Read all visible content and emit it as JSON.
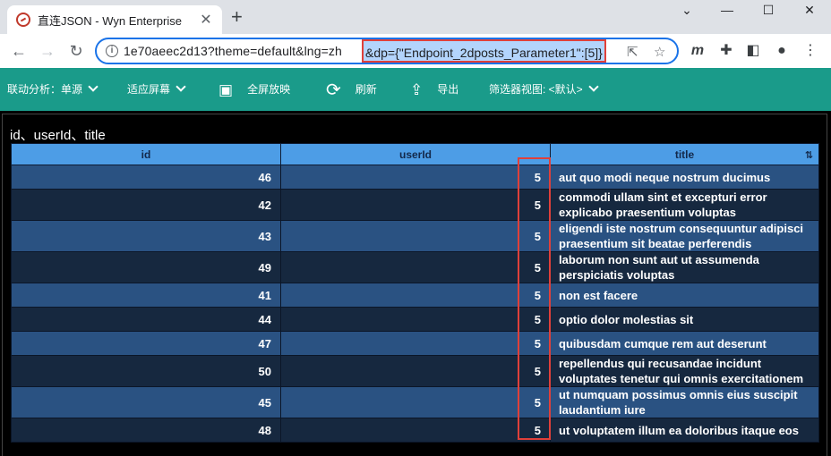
{
  "browser": {
    "tab_title": "直连JSON - Wyn Enterprise",
    "tab_close": "✕",
    "new_tab": "+",
    "url_prefix": "1e70aeec2d13?theme=default&lng=zh",
    "url_selected": "&dp={\"Endpoint_2dposts_Parameter1\":[5]}",
    "window": {
      "minimize": "⌄",
      "minimize2": "—",
      "maximize": "☐",
      "close": "✕"
    }
  },
  "toolbar": {
    "items": [
      {
        "label": "联动分析：单源",
        "icon": "",
        "has_chevron": true
      },
      {
        "label": "适应屏幕",
        "icon": "",
        "has_chevron": true
      },
      {
        "label": "全屏放映",
        "icon": "▣",
        "has_chevron": false
      },
      {
        "label": "刷新",
        "icon": "⟳",
        "has_chevron": false
      },
      {
        "label": "导出",
        "icon": "⇪",
        "has_chevron": false
      },
      {
        "label": "筛选器视图: <默认>",
        "icon": "",
        "has_chevron": true
      }
    ]
  },
  "report": {
    "title": "id、userId、title",
    "columns": [
      "id",
      "userId",
      "title"
    ],
    "rows": [
      {
        "id": "46",
        "userId": "5",
        "title": "aut quo modi neque nostrum ducimus"
      },
      {
        "id": "42",
        "userId": "5",
        "title": "commodi ullam sint et excepturi error explicabo praesentium voluptas"
      },
      {
        "id": "43",
        "userId": "5",
        "title": "eligendi iste nostrum consequuntur adipisci praesentium sit beatae perferendis"
      },
      {
        "id": "49",
        "userId": "5",
        "title": "laborum non sunt aut ut assumenda perspiciatis voluptas"
      },
      {
        "id": "41",
        "userId": "5",
        "title": "non est facere"
      },
      {
        "id": "44",
        "userId": "5",
        "title": "optio dolor molestias sit"
      },
      {
        "id": "47",
        "userId": "5",
        "title": "quibusdam cumque rem aut deserunt"
      },
      {
        "id": "50",
        "userId": "5",
        "title": "repellendus qui recusandae incidunt voluptates tenetur qui omnis exercitationem"
      },
      {
        "id": "45",
        "userId": "5",
        "title": "ut numquam possimus omnis eius suscipit laudantium iure"
      },
      {
        "id": "48",
        "userId": "5",
        "title": "ut voluptatem illum ea doloribus itaque eos"
      }
    ]
  },
  "colors": {
    "app_toolbar": "#1a9b8a",
    "header_bg": "#4d9de6",
    "row_odd": "#2a5282",
    "row_even": "#16283f",
    "highlight": "#e0403a",
    "selection": "#b3d4fc"
  }
}
